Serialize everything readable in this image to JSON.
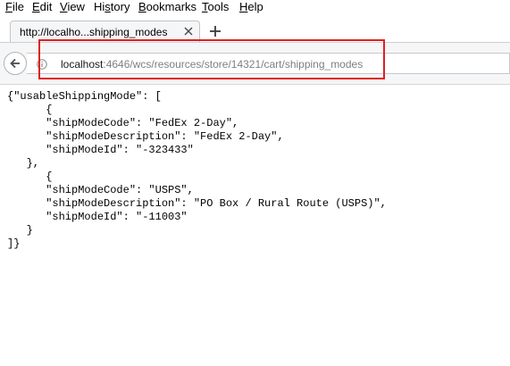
{
  "menu": {
    "file": {
      "key": "F",
      "rest": "ile"
    },
    "edit": {
      "key": "E",
      "rest": "dit"
    },
    "view": {
      "key": "V",
      "rest": "iew"
    },
    "history": {
      "pre": "Hi",
      "key": "s",
      "rest": "tory"
    },
    "bookmarks": {
      "key": "B",
      "rest": "ookmarks"
    },
    "tools": {
      "key": "T",
      "rest": "ools"
    },
    "help": {
      "key": "H",
      "rest": "elp"
    }
  },
  "tab": {
    "title": "http://localho...shipping_modes",
    "close_icon": "close-icon",
    "new_tab_icon": "plus-icon"
  },
  "navbar": {
    "back_icon": "back-arrow-icon",
    "info_icon": "info-icon",
    "url_host": "localhost",
    "url_rest": ":4646/wcs/resources/store/14321/cart/shipping_modes",
    "highlight_color": "#e0201e"
  },
  "json_lines": [
    "{\"usableShippingMode\": [",
    "      {",
    "      \"shipModeCode\": \"FedEx 2-Day\",",
    "      \"shipModeDescription\": \"FedEx 2-Day\",",
    "      \"shipModeId\": \"-323433\"",
    "   },",
    "      {",
    "      \"shipModeCode\": \"USPS\",",
    "      \"shipModeDescription\": \"PO Box / Rural Route (USPS)\",",
    "      \"shipModeId\": \"-11003\"",
    "   }",
    "]}"
  ]
}
